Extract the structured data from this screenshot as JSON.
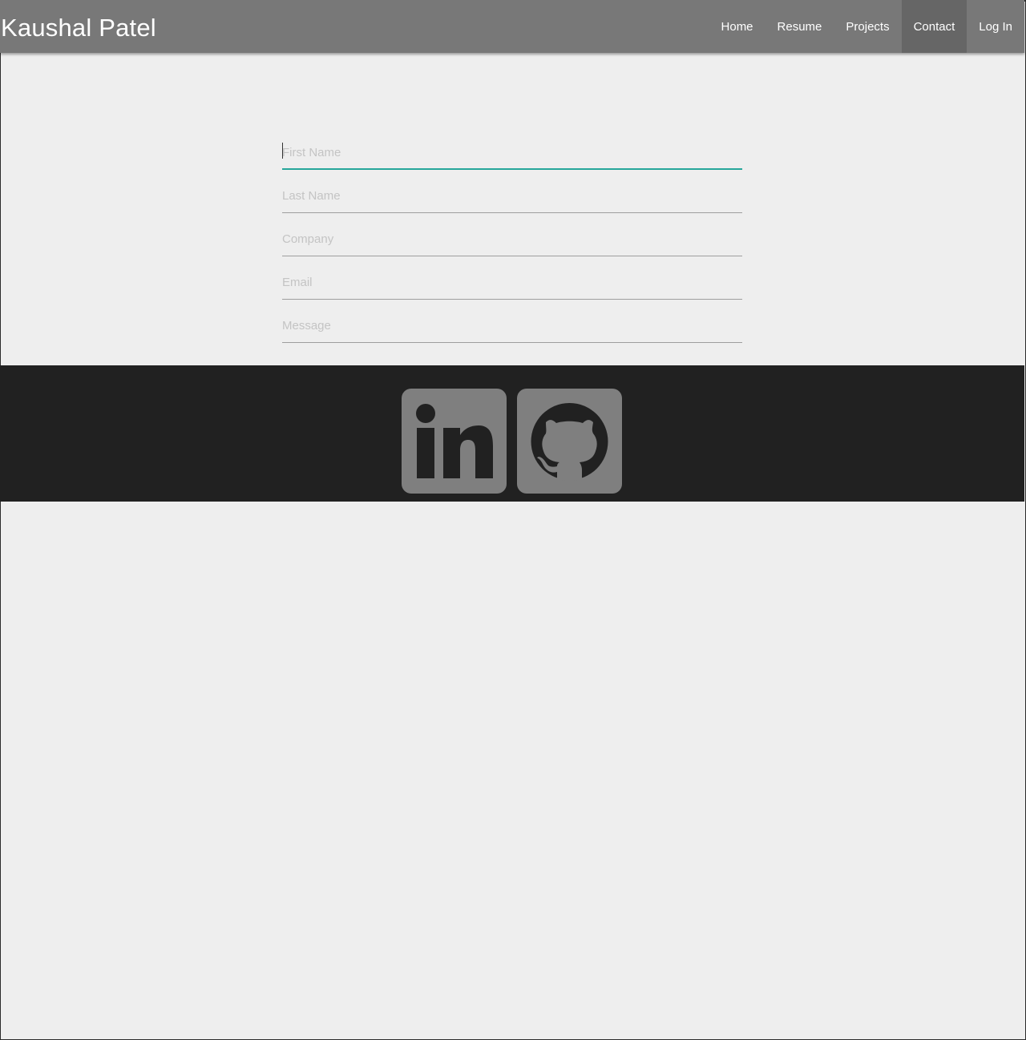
{
  "header": {
    "brand": "Kaushal Patel",
    "nav": [
      {
        "label": "Home"
      },
      {
        "label": "Resume"
      },
      {
        "label": "Projects"
      },
      {
        "label": "Contact",
        "active": true
      },
      {
        "label": "Log In"
      }
    ]
  },
  "form": {
    "first_name": {
      "placeholder": "First Name",
      "value": ""
    },
    "last_name": {
      "placeholder": "Last Name",
      "value": ""
    },
    "company": {
      "placeholder": "Company",
      "value": ""
    },
    "email": {
      "placeholder": "Email",
      "value": ""
    },
    "message": {
      "placeholder": "Message",
      "value": ""
    }
  },
  "footer": {
    "social": [
      {
        "icon": "linkedin-icon"
      },
      {
        "icon": "github-icon"
      }
    ]
  },
  "colors": {
    "navbar": "#787878",
    "nav_active": "#666666",
    "page_background": "#eeeeee",
    "footer_background": "#212121",
    "focus_accent": "#26a69a",
    "social_tile": "#7f7f7f"
  }
}
